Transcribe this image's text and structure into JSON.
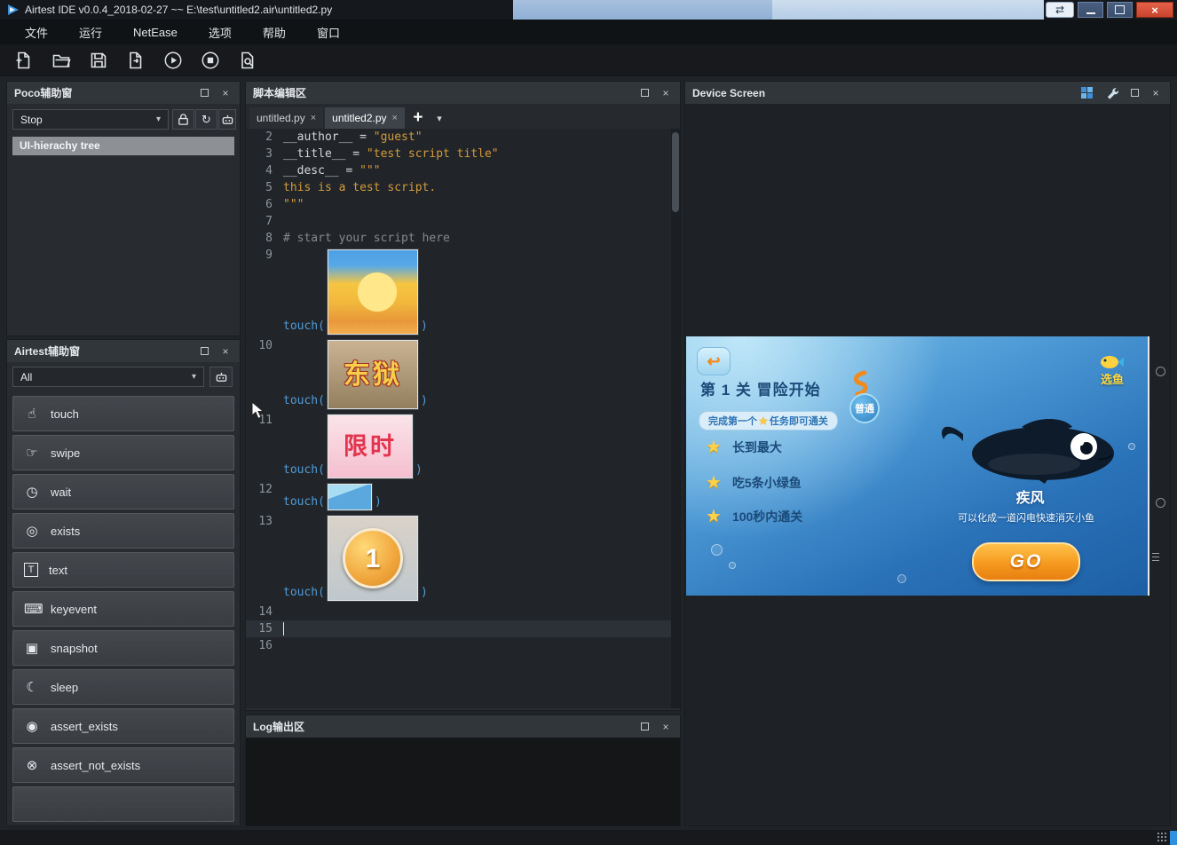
{
  "colors": {
    "accent_blue": "#4f9bd8",
    "string_orange": "#d29a3c",
    "comment_gray": "#85898c",
    "close_red": "#c8442c",
    "go_orange": "#f59a1f",
    "star_yellow": "#ffd24a"
  },
  "icons": {
    "close": "×",
    "plus": "+",
    "caret": "▾",
    "swap": "⇄",
    "refresh": "↻",
    "back_arrow": "↩",
    "star": "★"
  },
  "window": {
    "title": "Airtest IDE v0.0.4_2018-02-27 ~~ E:\\test\\untitled2.air\\untitled2.py"
  },
  "menu": {
    "items": [
      {
        "label": "文件"
      },
      {
        "label": "运行"
      },
      {
        "label": "NetEase"
      },
      {
        "label": "选项"
      },
      {
        "label": "帮助"
      },
      {
        "label": "窗口"
      }
    ]
  },
  "toolbar": {
    "icons": [
      "new-script",
      "open",
      "save",
      "save-as",
      "run",
      "stop",
      "find"
    ]
  },
  "poco": {
    "title": "Poco辅助窗",
    "mode_value": "Stop",
    "tree_header": "UI-hierachy tree"
  },
  "airtest": {
    "title": "Airtest辅助窗",
    "filter_value": "All",
    "actions": [
      {
        "label": "touch",
        "glyph": "☝"
      },
      {
        "label": "swipe",
        "glyph": "☞"
      },
      {
        "label": "wait",
        "glyph": "◷"
      },
      {
        "label": "exists",
        "glyph": "◎"
      },
      {
        "label": "text",
        "glyph": "T"
      },
      {
        "label": "keyevent",
        "glyph": "⌨"
      },
      {
        "label": "snapshot",
        "glyph": "▣"
      },
      {
        "label": "sleep",
        "glyph": "☾"
      },
      {
        "label": "assert_exists",
        "glyph": "◉"
      },
      {
        "label": "assert_not_exists",
        "glyph": "⊗"
      }
    ]
  },
  "editor": {
    "title": "脚本编辑区",
    "tabs": [
      {
        "label": "untitled.py"
      },
      {
        "label": "untitled2.py"
      }
    ],
    "lines": [
      {
        "num": "2",
        "plain": "__author__ = ",
        "string": "\"guest\""
      },
      {
        "num": "3",
        "plain": "__title__ = ",
        "string": "\"test script title\""
      },
      {
        "num": "4",
        "plain": "__desc__ = ",
        "string": "\"\"\""
      },
      {
        "num": "5",
        "string": "this is a test script."
      },
      {
        "num": "6",
        "string": "\"\"\""
      },
      {
        "num": "7"
      },
      {
        "num": "8",
        "comment": "# start your script here"
      },
      {
        "num": "9",
        "call": "touch(",
        "close": ")"
      },
      {
        "num": "10",
        "call": "touch(",
        "close": ")"
      },
      {
        "num": "11",
        "call": "touch(",
        "close": ")"
      },
      {
        "num": "12",
        "call": "touch(",
        "close": ")"
      },
      {
        "num": "13",
        "call": "touch(",
        "close": ")"
      },
      {
        "num": "14"
      },
      {
        "num": "15"
      },
      {
        "num": "16"
      }
    ],
    "thumbs": {
      "dongyu_text": "东狱",
      "limit_text": "限时",
      "medal_text": "1"
    }
  },
  "log": {
    "title": "Log输出区"
  },
  "device": {
    "title": "Device Screen",
    "game": {
      "level_title": "第 1 关 冒险开始",
      "difficulty": "普通",
      "subtitle_pre": "完成第一个",
      "subtitle_post": "任务即可通关",
      "objectives": [
        {
          "label": "长到最大"
        },
        {
          "label": "吃5条小绿鱼"
        },
        {
          "label": "100秒内通关"
        }
      ],
      "fish_name": "疾风",
      "fish_desc": "可以化成一道闪电快速消灭小鱼",
      "go_label": "GO",
      "select_fish": "选鱼"
    }
  }
}
